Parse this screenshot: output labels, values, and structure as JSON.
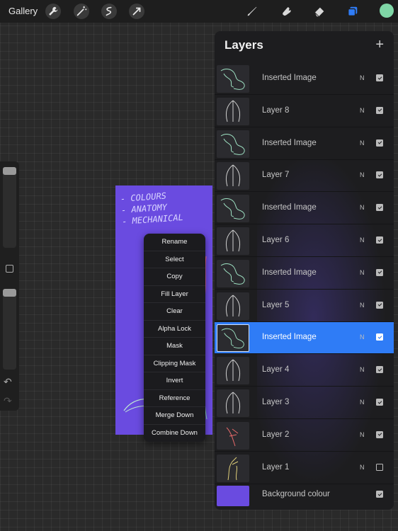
{
  "topbar": {
    "gallery_label": "Gallery",
    "icons": [
      "wrench-icon",
      "magic-wand-icon",
      "selection-icon",
      "transform-arrow-icon",
      "brush-icon",
      "smudge-icon",
      "eraser-icon",
      "layers-icon"
    ],
    "active_color": "#7fd6a6"
  },
  "sidebar": {
    "undo_glyph": "↶",
    "redo_glyph": "↷"
  },
  "canvas": {
    "background": "#6a4be0",
    "notes": [
      "- COLOURS",
      "- ANATOMY",
      "- MECHANICAL"
    ]
  },
  "context_menu": {
    "items": [
      "Rename",
      "Select",
      "Copy",
      "Fill Layer",
      "Clear",
      "Alpha Lock",
      "Mask",
      "Clipping Mask",
      "Invert",
      "Reference",
      "Merge Down",
      "Combine Down"
    ]
  },
  "layers_panel": {
    "title": "Layers",
    "add_glyph": "+",
    "layers": [
      {
        "name": "Inserted Image",
        "blend": "N",
        "visible": true,
        "selected": false
      },
      {
        "name": "Layer 8",
        "blend": "N",
        "visible": true,
        "selected": false
      },
      {
        "name": "Inserted Image",
        "blend": "N",
        "visible": true,
        "selected": false
      },
      {
        "name": "Layer 7",
        "blend": "N",
        "visible": true,
        "selected": false
      },
      {
        "name": "Inserted Image",
        "blend": "N",
        "visible": true,
        "selected": false
      },
      {
        "name": "Layer 6",
        "blend": "N",
        "visible": true,
        "selected": false
      },
      {
        "name": "Inserted Image",
        "blend": "N",
        "visible": true,
        "selected": false
      },
      {
        "name": "Layer 5",
        "blend": "N",
        "visible": true,
        "selected": false
      },
      {
        "name": "Inserted Image",
        "blend": "N",
        "visible": true,
        "selected": true
      },
      {
        "name": "Layer 4",
        "blend": "N",
        "visible": true,
        "selected": false
      },
      {
        "name": "Layer 3",
        "blend": "N",
        "visible": true,
        "selected": false
      },
      {
        "name": "Layer 2",
        "blend": "N",
        "visible": true,
        "selected": false
      },
      {
        "name": "Layer 1",
        "blend": "N",
        "visible": false,
        "selected": false
      }
    ],
    "background": {
      "name": "Background colour",
      "color": "#6a4be0",
      "visible": true
    }
  }
}
